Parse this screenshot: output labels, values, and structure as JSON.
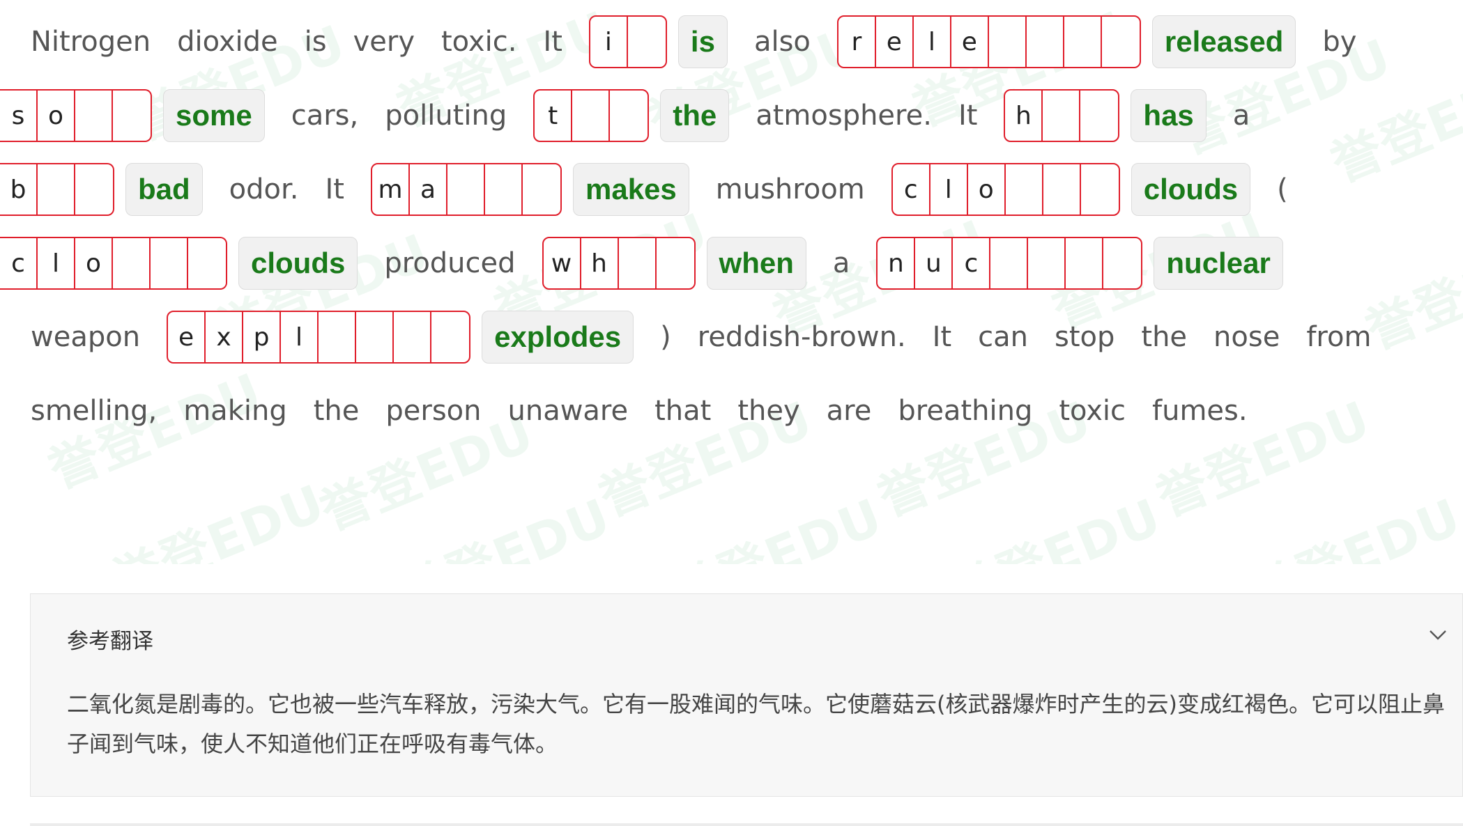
{
  "watermark": {
    "text": "誉登EDU"
  },
  "passage": {
    "lines": [
      [
        {
          "t": "word",
          "text": "Nitrogen"
        },
        {
          "t": "word",
          "text": "dioxide"
        },
        {
          "t": "word",
          "text": "is"
        },
        {
          "t": "word",
          "text": "very"
        },
        {
          "t": "word",
          "text": "toxic."
        },
        {
          "t": "word",
          "text": "It"
        },
        {
          "t": "blank",
          "letters": [
            "i",
            ""
          ],
          "answer": "is"
        },
        {
          "t": "word",
          "text": "also"
        },
        {
          "t": "blank",
          "letters": [
            "r",
            "e",
            "l",
            "e",
            "",
            "",
            "",
            ""
          ],
          "answer": "released"
        },
        {
          "t": "word",
          "text": "by"
        }
      ],
      [
        {
          "t": "blank",
          "letters": [
            "s",
            "o",
            "",
            ""
          ],
          "answer": "some",
          "bleed": true
        },
        {
          "t": "word",
          "text": "cars,"
        },
        {
          "t": "word",
          "text": "polluting"
        },
        {
          "t": "blank",
          "letters": [
            "t",
            "",
            ""
          ],
          "answer": "the"
        },
        {
          "t": "word",
          "text": "atmosphere."
        },
        {
          "t": "word",
          "text": "It"
        },
        {
          "t": "blank",
          "letters": [
            "h",
            "",
            ""
          ],
          "answer": "has"
        },
        {
          "t": "word",
          "text": "a"
        }
      ],
      [
        {
          "t": "blank",
          "letters": [
            "b",
            "",
            ""
          ],
          "answer": "bad",
          "bleed": true
        },
        {
          "t": "word",
          "text": "odor."
        },
        {
          "t": "word",
          "text": "It"
        },
        {
          "t": "blank",
          "letters": [
            "m",
            "a",
            "",
            "",
            ""
          ],
          "answer": "makes"
        },
        {
          "t": "word",
          "text": "mushroom"
        },
        {
          "t": "blank",
          "letters": [
            "c",
            "l",
            "o",
            "",
            "",
            ""
          ],
          "answer": "clouds"
        },
        {
          "t": "word",
          "text": "("
        }
      ],
      [
        {
          "t": "blank",
          "letters": [
            "c",
            "l",
            "o",
            "",
            "",
            ""
          ],
          "answer": "clouds",
          "bleed": true
        },
        {
          "t": "word",
          "text": "produced"
        },
        {
          "t": "blank",
          "letters": [
            "w",
            "h",
            "",
            ""
          ],
          "answer": "when"
        },
        {
          "t": "word",
          "text": "a"
        },
        {
          "t": "blank",
          "letters": [
            "n",
            "u",
            "c",
            "",
            "",
            "",
            ""
          ],
          "answer": "nuclear"
        }
      ],
      [
        {
          "t": "word",
          "text": "weapon"
        },
        {
          "t": "blank",
          "letters": [
            "e",
            "x",
            "p",
            "l",
            "",
            "",
            "",
            ""
          ],
          "answer": "explodes"
        },
        {
          "t": "word",
          "text": ")"
        },
        {
          "t": "word",
          "text": "reddish-brown."
        },
        {
          "t": "word",
          "text": "It"
        },
        {
          "t": "word",
          "text": "can"
        },
        {
          "t": "word",
          "text": "stop"
        },
        {
          "t": "word",
          "text": "the"
        },
        {
          "t": "word",
          "text": "nose"
        },
        {
          "t": "word",
          "text": "from"
        }
      ],
      [
        {
          "t": "word",
          "text": "smelling,"
        },
        {
          "t": "word",
          "text": "making"
        },
        {
          "t": "word",
          "text": "the"
        },
        {
          "t": "word",
          "text": "person"
        },
        {
          "t": "word",
          "text": "unaware"
        },
        {
          "t": "word",
          "text": "that"
        },
        {
          "t": "word",
          "text": "they"
        },
        {
          "t": "word",
          "text": "are"
        },
        {
          "t": "word",
          "text": "breathing"
        },
        {
          "t": "word",
          "text": "toxic"
        },
        {
          "t": "word",
          "text": "fumes."
        }
      ]
    ]
  },
  "translation_panel": {
    "title": "参考翻译",
    "expand_icon": "chevron-down-icon",
    "body": "二氧化氮是剧毒的。它也被一些汽车释放，污染大气。它有一股难闻的气味。它使蘑菇云(核武器爆炸时产生的云)变成红褐色。它可以阻止鼻子闻到气味，使人不知道他们正在呼吸有毒气体。"
  },
  "colors": {
    "cell_border": "#e01e2b",
    "answer_text": "#1a7a1a",
    "answer_bg": "#f1f1f1",
    "word_text": "#555555"
  }
}
